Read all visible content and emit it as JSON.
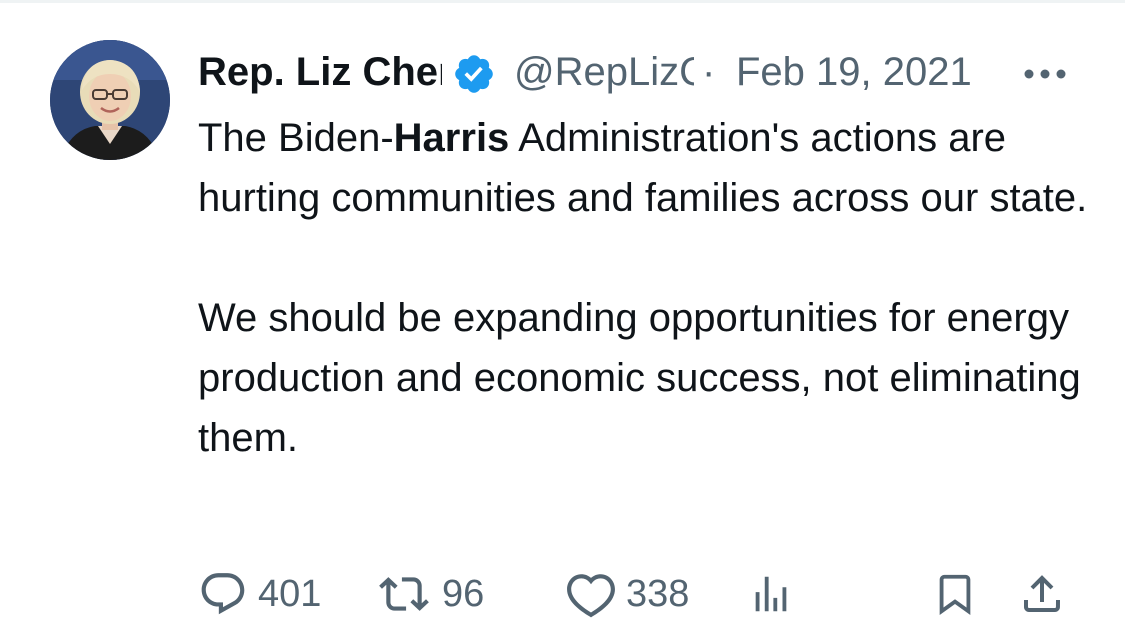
{
  "tweet": {
    "author": {
      "display_name": "Rep. Liz Cheney",
      "handle": "@RepLizCheney",
      "verified": true
    },
    "separator": "·",
    "date": "Feb 19, 2021",
    "text": {
      "p1_part1": "The Biden-",
      "p1_bold": "Harris",
      "p1_part2": " Administration's actions are hurting communities and families across our state.",
      "p2": "We should be expanding opportunities for energy production and economic success, not eliminating them."
    },
    "stats": {
      "replies": "401",
      "reposts": "96",
      "likes": "338"
    }
  },
  "colors": {
    "text": "#0f1419",
    "muted": "#536471",
    "verified": "#1d9bf0",
    "divider": "#eff3f4"
  },
  "icons": [
    "verified-badge-icon",
    "more-icon",
    "reply-icon",
    "repost-icon",
    "like-icon",
    "views-icon",
    "bookmark-icon",
    "share-icon"
  ]
}
